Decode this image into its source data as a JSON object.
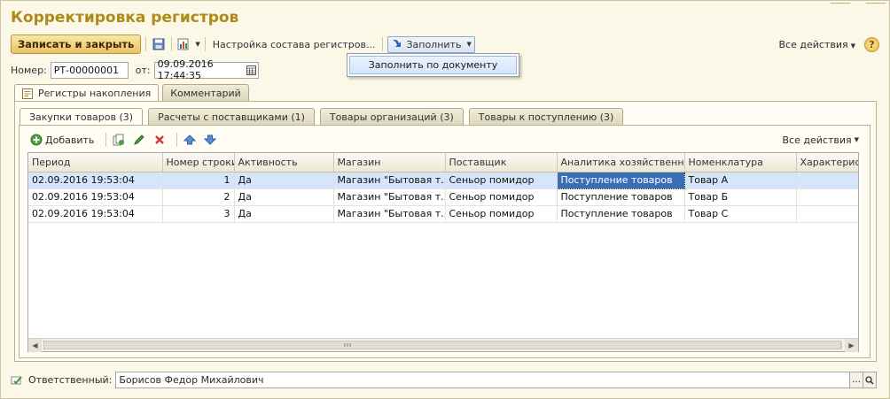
{
  "window": {
    "title": "Корректировка регистров"
  },
  "toolbar": {
    "save_close": "Записать и закрыть",
    "setup_registers": "Настройка состава регистров...",
    "fill": "Заполнить",
    "all_actions": "Все действия",
    "help": "?"
  },
  "fill_menu": {
    "items": [
      "Заполнить по документу"
    ]
  },
  "header": {
    "number_label": "Номер:",
    "number_value": "РТ-00000001",
    "date_label": "от:",
    "date_value": "09.09.2016 17:44:35"
  },
  "outer_tabs": [
    "Регистры накопления",
    "Комментарий"
  ],
  "inner_tabs": [
    "Закупки товаров (3)",
    "Расчеты с поставщиками (1)",
    "Товары организаций (3)",
    "Товары к поступлению (3)"
  ],
  "table_toolbar": {
    "add": "Добавить",
    "all_actions": "Все действия"
  },
  "table": {
    "columns": [
      "Период",
      "Номер строки",
      "Активность",
      "Магазин",
      "Поставщик",
      "Аналитика хозяйственно...",
      "Номенклатура",
      "Характеристи"
    ],
    "rows": [
      [
        "02.09.2016 19:53:04",
        "1",
        "Да",
        "Магазин \"Бытовая т...",
        "Сеньор помидор",
        "Поступление товаров",
        "Товар А",
        ""
      ],
      [
        "02.09.2016 19:53:04",
        "2",
        "Да",
        "Магазин \"Бытовая т...",
        "Сеньор помидор",
        "Поступление товаров",
        "Товар Б",
        ""
      ],
      [
        "02.09.2016 19:53:04",
        "3",
        "Да",
        "Магазин \"Бытовая т...",
        "Сеньор помидор",
        "Поступление товаров",
        "Товар С",
        ""
      ]
    ]
  },
  "footer": {
    "responsible_label": "Ответственный:",
    "responsible_value": "Борисов Федор Михайлович"
  },
  "colors": {
    "title": "#b08a18",
    "selection": "#d6e6fa",
    "current_cell": "#3a6fb8"
  }
}
